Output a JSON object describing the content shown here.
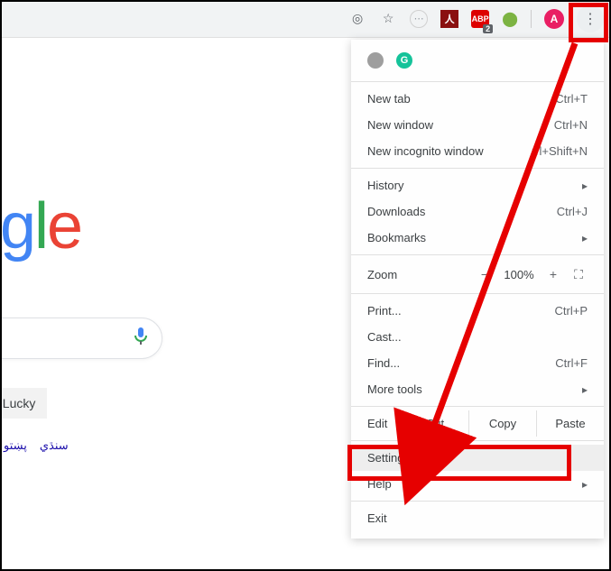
{
  "toolbar": {
    "abp_badge": "2",
    "avatar_initial": "A"
  },
  "extensions": {
    "grammarly_letter": "G"
  },
  "google": {
    "logo_fragment_g": "g",
    "logo_fragment_l": "l",
    "logo_fragment_e": "e",
    "lucky_label": "Feeling Lucky",
    "lang1": "پښتو",
    "lang2": "سنڌي"
  },
  "menu": {
    "new_tab": "New tab",
    "new_tab_sc": "Ctrl+T",
    "new_window": "New window",
    "new_window_sc": "Ctrl+N",
    "incognito": "New incognito window",
    "incognito_sc": "trl+Shift+N",
    "history": "History",
    "downloads": "Downloads",
    "downloads_sc": "Ctrl+J",
    "bookmarks": "Bookmarks",
    "zoom_label": "Zoom",
    "zoom_value": "100%",
    "print": "Print...",
    "print_sc": "Ctrl+P",
    "cast": "Cast...",
    "find": "Find...",
    "find_sc": "Ctrl+F",
    "more_tools": "More tools",
    "edit_label": "Edit",
    "cut": "Cut",
    "copy": "Copy",
    "paste": "Paste",
    "settings": "Settings",
    "help": "Help",
    "exit": "Exit"
  }
}
